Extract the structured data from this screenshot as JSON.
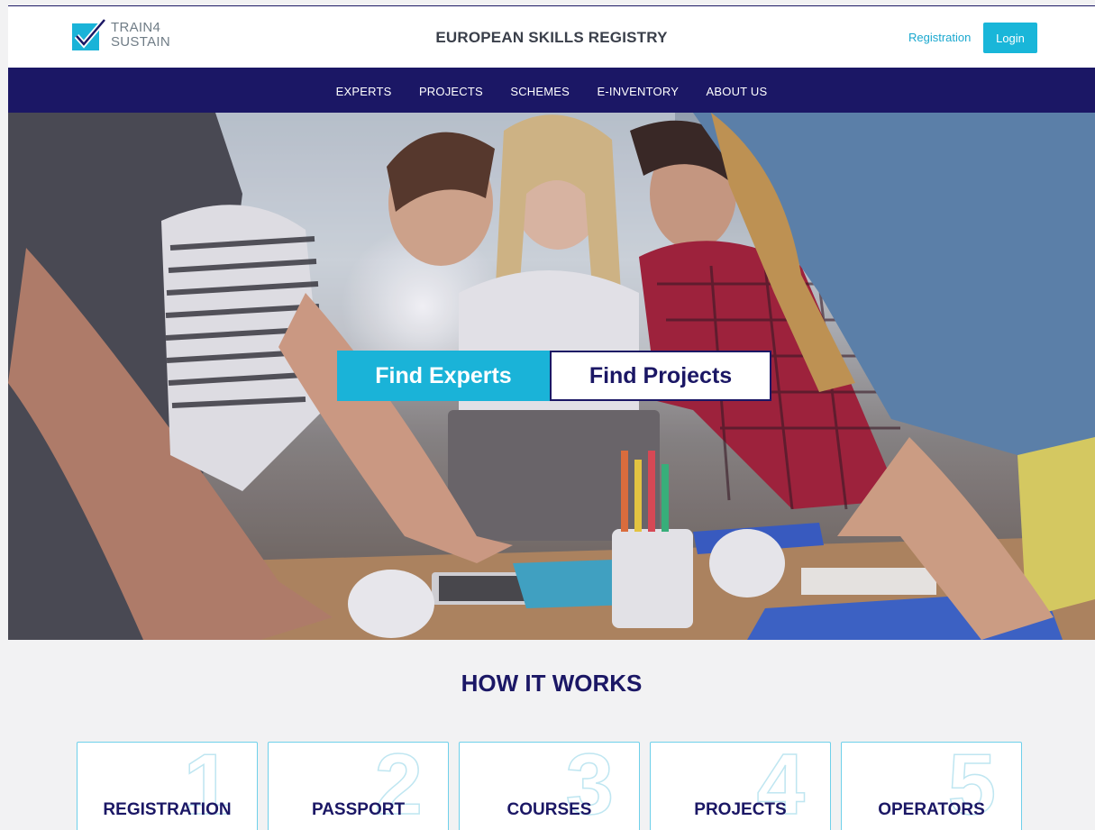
{
  "header": {
    "logo_line1": "TRAIN4",
    "logo_line2": "SUSTAIN",
    "title": "EUROPEAN SKILLS REGISTRY",
    "registration_label": "Registration",
    "login_label": "Login"
  },
  "nav": {
    "items": [
      {
        "label": "EXPERTS"
      },
      {
        "label": "PROJECTS"
      },
      {
        "label": "SCHEMES"
      },
      {
        "label": "E-INVENTORY"
      },
      {
        "label": "ABOUT US"
      }
    ]
  },
  "hero": {
    "find_experts_label": "Find Experts",
    "find_projects_label": "Find Projects"
  },
  "how_it_works": {
    "title": "HOW IT WORKS",
    "cards": [
      {
        "number": "1",
        "label": "REGISTRATION"
      },
      {
        "number": "2",
        "label": "PASSPORT"
      },
      {
        "number": "3",
        "label": "COURSES"
      },
      {
        "number": "4",
        "label": "PROJECTS"
      },
      {
        "number": "5",
        "label": "OPERATORS"
      }
    ]
  },
  "colors": {
    "brand_navy": "#1b1765",
    "accent_cyan": "#19b6d9"
  }
}
